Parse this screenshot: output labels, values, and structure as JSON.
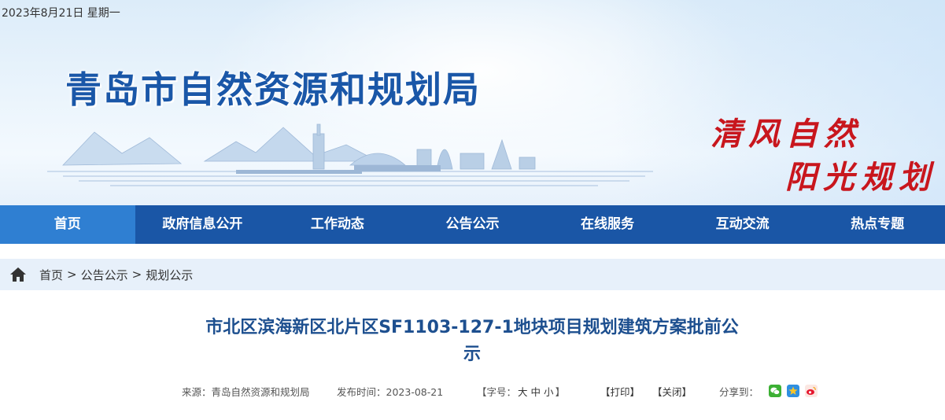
{
  "header": {
    "date": "2023年8月21日 星期一",
    "site_title": "青岛市自然资源和规划局",
    "slogan_line1": "清风自然",
    "slogan_line2": "阳光规划"
  },
  "nav": {
    "items": [
      "首页",
      "政府信息公开",
      "工作动态",
      "公告公示",
      "在线服务",
      "互动交流",
      "热点专题"
    ],
    "active_index": 0
  },
  "breadcrumb": {
    "items": [
      "首页",
      "公告公示",
      "规划公示"
    ],
    "separator": ">"
  },
  "article": {
    "title_line1": "市北区滨海新区北片区SF1103-127-1地块项目规划建筑方案批前公",
    "title_line2": "示",
    "source_label": "来源：",
    "source": "青岛自然资源和规划局",
    "time_label": "发布时间：",
    "time": "2023-08-21",
    "font_size_label": "【字号：",
    "font_sizes": [
      "大",
      "中",
      "小"
    ],
    "font_size_close": "】",
    "print": "【打印】",
    "close": "【关闭】",
    "share_label": "分享到："
  },
  "share_icons": [
    "wechat-icon",
    "qzone-icon",
    "weibo-icon"
  ],
  "colors": {
    "nav_bg": "#1a56a6",
    "nav_active": "#2f7fd2",
    "title_blue": "#1a57a8",
    "slogan_red": "#c8161d",
    "breadcrumb_bg": "#e7f0fa"
  }
}
